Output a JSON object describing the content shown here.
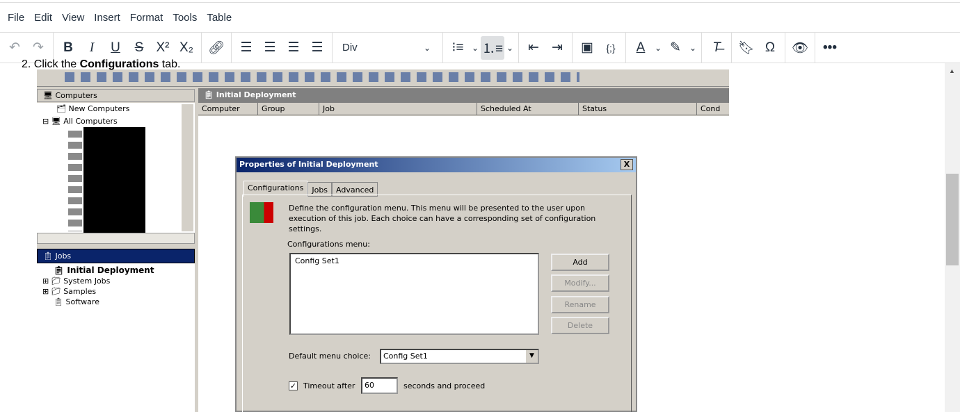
{
  "menubar": [
    "File",
    "Edit",
    "View",
    "Insert",
    "Format",
    "Tools",
    "Table"
  ],
  "toolbar": {
    "block_format": "Div"
  },
  "content": {
    "step_number": "2.",
    "step_prefix": "Click the ",
    "step_bold": "Configurations",
    "step_suffix": " tab."
  },
  "screenshot": {
    "computers_header": "Computers",
    "computer_tree": [
      "New Computers",
      "All Computers"
    ],
    "jobs_header": "Jobs",
    "jobs_tree": [
      "Initial Deployment",
      "System Jobs",
      "Samples",
      "Software"
    ],
    "pane_title": "Initial Deployment",
    "columns": [
      "Computer",
      "Group",
      "Job",
      "Scheduled At",
      "Status",
      "Cond"
    ],
    "dialog": {
      "title": "Properties of Initial Deployment",
      "close": "X",
      "tabs": [
        "Configurations",
        "Jobs",
        "Advanced"
      ],
      "description": "Define the configuration menu. This menu will be presented to the user upon execution of this job. Each choice can have a corresponding set of configuration settings.",
      "menu_label": "Configurations menu:",
      "menu_items": [
        "Config Set1"
      ],
      "buttons": [
        "Add",
        "Modify...",
        "Rename",
        "Delete"
      ],
      "default_label": "Default menu choice:",
      "default_value": "Config Set1",
      "timeout_label": "Timeout after",
      "timeout_value": "60",
      "timeout_suffix": "seconds and proceed",
      "timeout_checked": true
    }
  }
}
